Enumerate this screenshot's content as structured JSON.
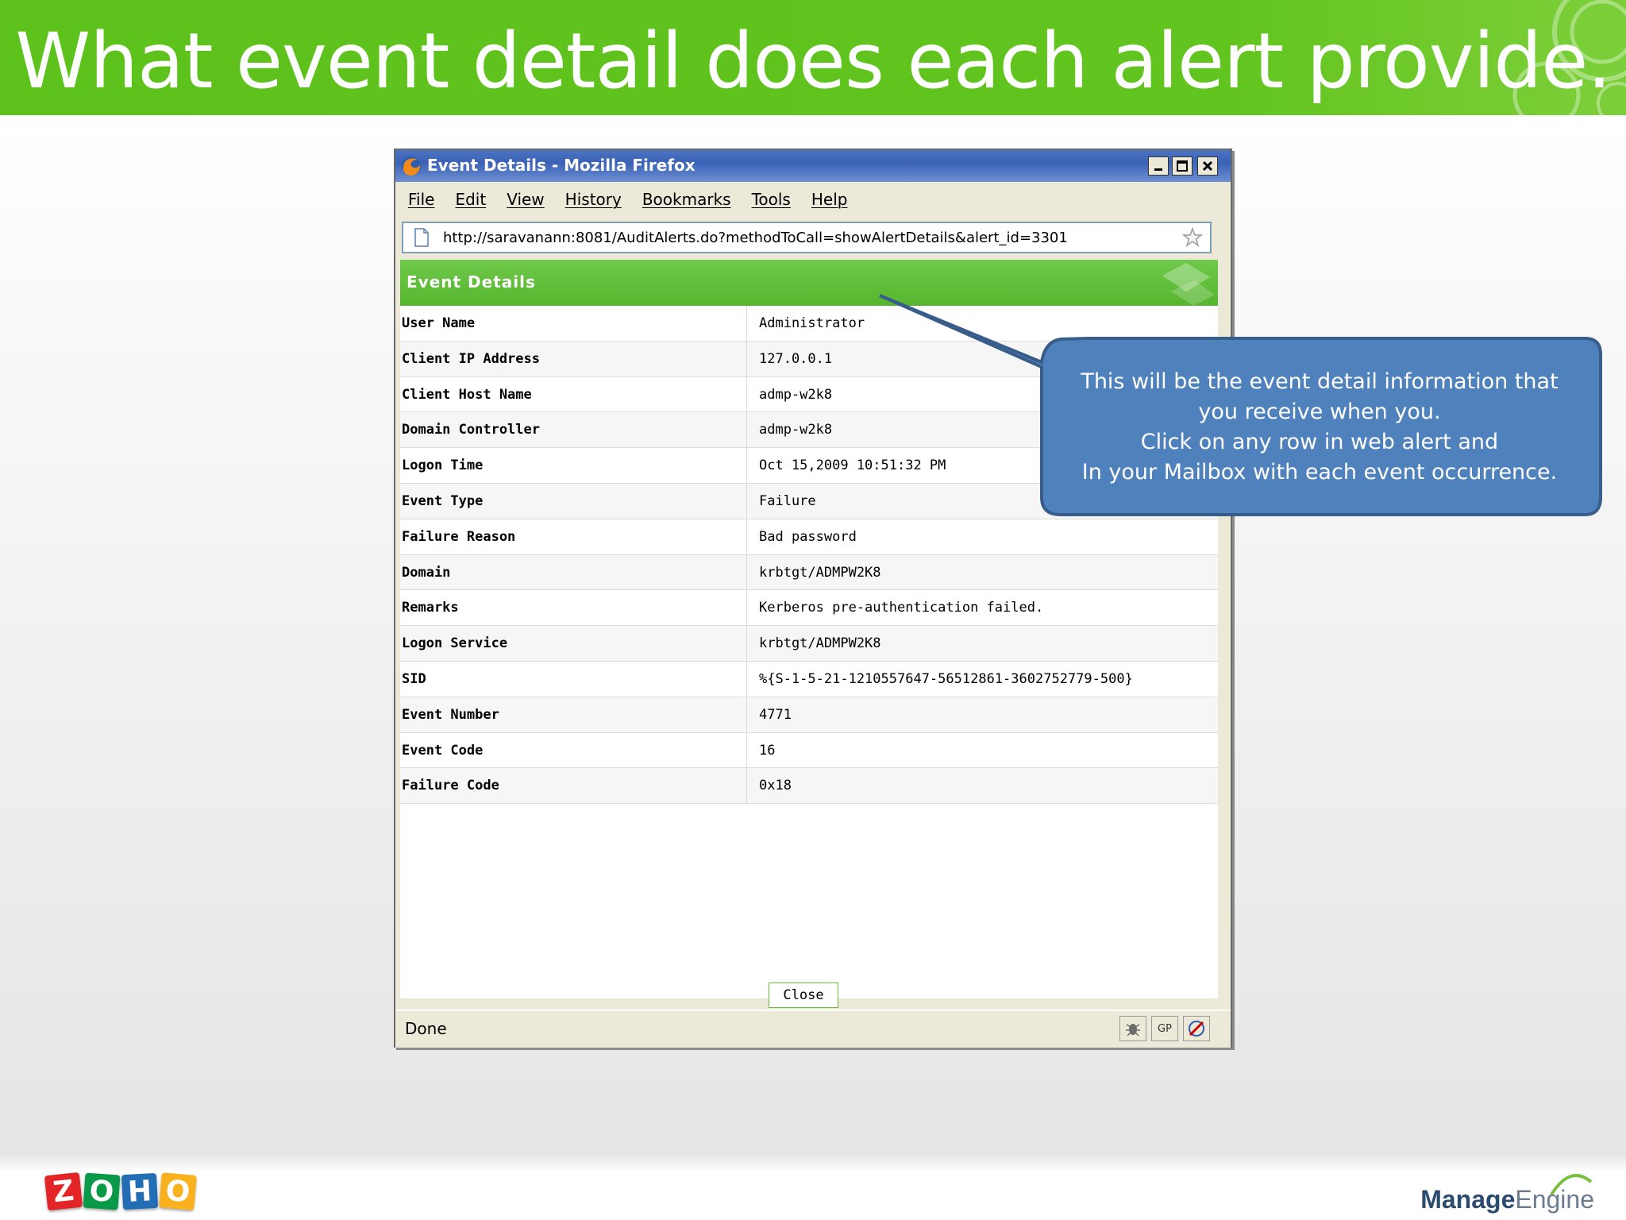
{
  "slide": {
    "title": "What event detail does each alert provide."
  },
  "window": {
    "title": "Event Details - Mozilla Firefox",
    "menu": [
      "File",
      "Edit",
      "View",
      "History",
      "Bookmarks",
      "Tools",
      "Help"
    ],
    "url": "http://saravanann:8081/AuditAlerts.do?methodToCall=showAlertDetails&alert_id=3301",
    "status": "Done",
    "status_icons": {
      "gp": "GP"
    }
  },
  "event_details": {
    "heading": "Event Details",
    "rows": [
      {
        "label": "User Name",
        "value": "Administrator"
      },
      {
        "label": "Client IP Address",
        "value": "127.0.0.1"
      },
      {
        "label": "Client Host Name",
        "value": "admp-w2k8"
      },
      {
        "label": "Domain Controller",
        "value": "admp-w2k8"
      },
      {
        "label": "Logon Time",
        "value": "Oct 15,2009 10:51:32 PM"
      },
      {
        "label": "Event Type",
        "value": "Failure"
      },
      {
        "label": "Failure Reason",
        "value": "Bad password"
      },
      {
        "label": "Domain",
        "value": "krbtgt/ADMPW2K8"
      },
      {
        "label": "Remarks",
        "value": "Kerberos pre-authentication failed."
      },
      {
        "label": "Logon Service",
        "value": "krbtgt/ADMPW2K8"
      },
      {
        "label": "SID",
        "value": "%{S-1-5-21-1210557647-56512861-3602752779-500}"
      },
      {
        "label": "Event Number",
        "value": "4771"
      },
      {
        "label": "Event Code",
        "value": "16"
      },
      {
        "label": "Failure Code",
        "value": "0x18"
      }
    ],
    "close_label": "Close"
  },
  "callout": {
    "lines": [
      "This will be the event detail information that",
      "you receive when you.",
      "Click on any row in web alert and",
      "In your Mailbox with each event occurrence."
    ],
    "fill": "#4f81bd"
  },
  "footer": {
    "zoho_letters": [
      "Z",
      "O",
      "H",
      "O"
    ],
    "zoho_colors": [
      "#e42527",
      "#089949",
      "#226db4",
      "#f9b21d"
    ],
    "brand_bold": "Manage",
    "brand_light": "Engine"
  }
}
